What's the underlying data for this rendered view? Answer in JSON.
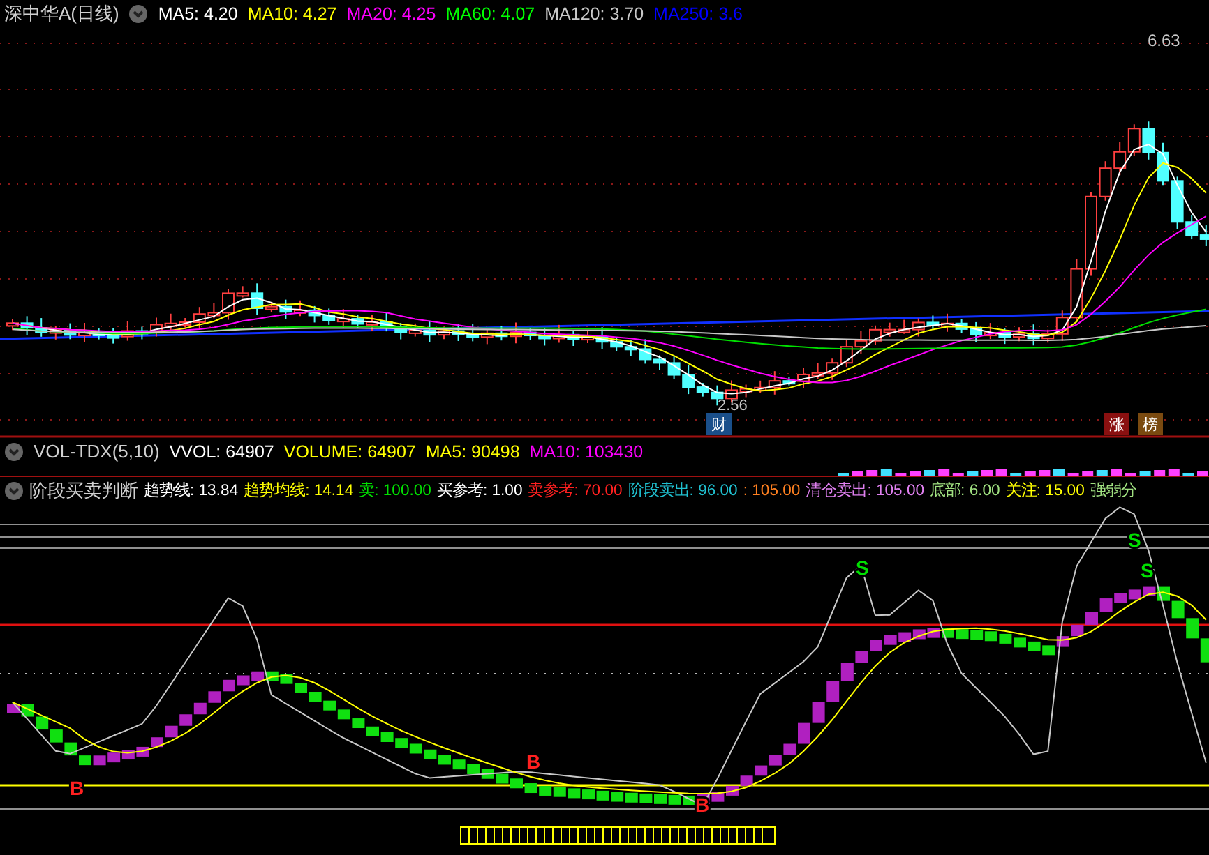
{
  "main_header": {
    "title": "深中华A(日线)",
    "items": [
      {
        "label": "MA5: 4.20",
        "color": "#ffffff"
      },
      {
        "label": "MA10: 4.27",
        "color": "#ffff00"
      },
      {
        "label": "MA20: 4.25",
        "color": "#ff00ff"
      },
      {
        "label": "MA60: 4.07",
        "color": "#00ff00"
      },
      {
        "label": "MA120: 3.70",
        "color": "#c8c8c8"
      },
      {
        "label": "MA250: 3.6",
        "color": "#0000ff"
      }
    ]
  },
  "main_chart": {
    "high_label": "6.63",
    "low_label": "2.56",
    "badges": [
      {
        "label": "财",
        "color": "#1a4f8a"
      },
      {
        "label": "涨",
        "color": "#8a1010"
      },
      {
        "label": "榜",
        "color": "#7a4a10"
      }
    ]
  },
  "volume_header": {
    "title": "VOL-TDX(5,10)",
    "items": [
      {
        "label": "VVOL: 64907",
        "color": "#ffffff"
      },
      {
        "label": "VOLUME: 64907",
        "color": "#ffff00"
      },
      {
        "label": "MA5: 90498",
        "color": "#ffff00"
      },
      {
        "label": "MA10: 103430",
        "color": "#ff00ff"
      }
    ]
  },
  "indicator_header": {
    "title": "阶段买卖判断",
    "items": [
      {
        "label": "趋势线: 13.84",
        "color": "#ffffff"
      },
      {
        "label": "趋势均线: 14.14",
        "color": "#ffff00"
      },
      {
        "label": "卖: 100.00",
        "color": "#00e000"
      },
      {
        "label": "买参考: 1.00",
        "color": "#ffffff"
      },
      {
        "label": "卖参考: 70.00",
        "color": "#ff2020"
      },
      {
        "label": "阶段卖出: 96.00",
        "color": "#20c0d0"
      },
      {
        "label": ": 105.00",
        "color": "#ff8020"
      },
      {
        "label": "清仓卖出: 105.00",
        "color": "#e080f0"
      },
      {
        "label": "底部: 6.00",
        "color": "#a0e080"
      },
      {
        "label": "关注: 15.00",
        "color": "#ffff00"
      },
      {
        "label": "强弱分",
        "color": "#a0e080"
      }
    ]
  },
  "signals": [
    {
      "label": "B",
      "kind": "buy"
    },
    {
      "label": "B",
      "kind": "buy"
    },
    {
      "label": "B",
      "kind": "buy"
    },
    {
      "label": "S",
      "kind": "sell"
    },
    {
      "label": "S",
      "kind": "sell"
    },
    {
      "label": "S",
      "kind": "sell"
    }
  ]
}
